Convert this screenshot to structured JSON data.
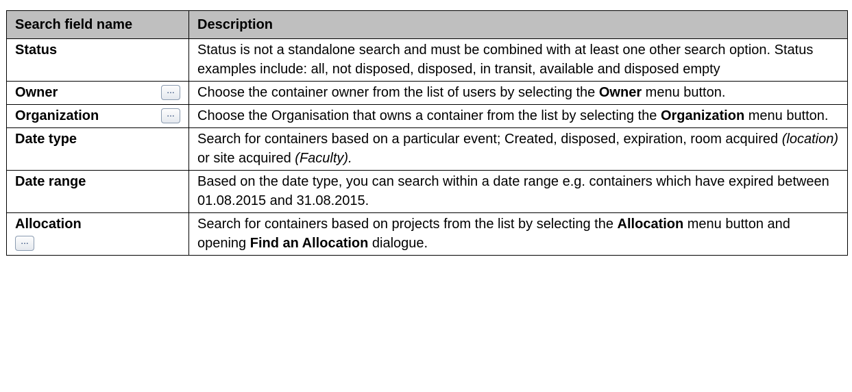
{
  "table": {
    "headers": {
      "field": "Search field name",
      "description": "Description"
    },
    "rows": [
      {
        "name": "Status",
        "description": "Status is not a standalone search and must be combined with at least one other search option. Status examples include: all, not disposed, disposed, in transit, available and disposed empty"
      },
      {
        "name": "Owner",
        "menu_button_label": "...",
        "desc_before": "Choose the container owner from the list of users by selecting the ",
        "desc_bold": "Owner",
        "desc_after": " menu button."
      },
      {
        "name": "Organization",
        "menu_button_label": "...",
        "desc_before": "Choose the Organisation that owns a container from the list by selecting the ",
        "desc_bold": "Organization",
        "desc_after": " menu button."
      },
      {
        "name": "Date type",
        "desc_before": "Search for containers based on a particular event; Created, disposed, expiration, room acquired ",
        "desc_italic_1": "(location)",
        "desc_middle": " or site acquired ",
        "desc_italic_2": "(Faculty)."
      },
      {
        "name": "Date range",
        "description": "Based on the date type, you can search within a date range e.g. containers which have expired between 01.08.2015 and 31.08.2015."
      },
      {
        "name": "Allocation",
        "menu_button_label": "...",
        "desc_before": "Search for containers based on projects from the list by selecting the ",
        "desc_bold_1": "Allocation",
        "desc_middle": " menu button and opening ",
        "desc_bold_2": "Find an Allocation",
        "desc_after": " dialogue."
      }
    ]
  }
}
